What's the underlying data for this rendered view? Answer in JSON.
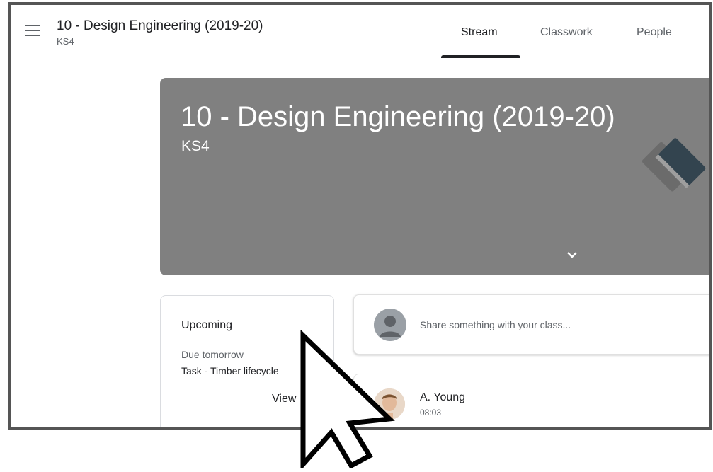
{
  "header": {
    "course_title": "10 - Design Engineering (2019-20)",
    "course_section": "KS4",
    "menu_icon": "hamburger-menu-icon"
  },
  "tabs": [
    {
      "label": "Stream",
      "active": true
    },
    {
      "label": "Classwork",
      "active": false
    },
    {
      "label": "People",
      "active": false
    }
  ],
  "banner": {
    "title": "10 - Design Engineering (2019-20)",
    "section": "KS4",
    "background_color": "#808080",
    "expand_icon": "chevron-down-icon",
    "illustration_icon": "books-icon"
  },
  "upcoming": {
    "title": "Upcoming",
    "due_label": "Due tomorrow",
    "task": "Task - Timber lifecycle",
    "view_label": "View"
  },
  "share": {
    "placeholder": "Share something with your class..."
  },
  "post": {
    "author": "A. Young",
    "time": "08:03"
  }
}
